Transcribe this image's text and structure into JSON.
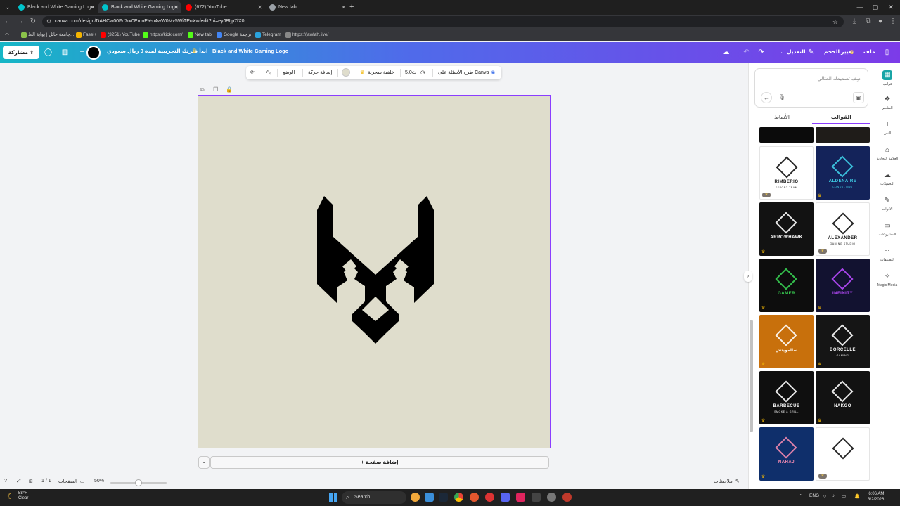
{
  "browser": {
    "tabs": [
      {
        "title": "Black and White Gaming Logo",
        "favicon_color": "#00c4cc",
        "active": false
      },
      {
        "title": "Black and White Gaming Logo",
        "favicon_color": "#00c4cc",
        "active": true
      },
      {
        "title": "(672) YouTube",
        "favicon_color": "#ff0000",
        "active": false
      },
      {
        "title": "New tab",
        "favicon_color": "#9aa0a6",
        "active": false
      }
    ],
    "url": "canva.com/design/DAHCw00Fn7o/0EmnEY-u4wW0Mv5WiTEuXw/edit?ui=eyJBIjp7fX0",
    "bookmarks": [
      {
        "label": "جامعة حائل | بوابة الط...",
        "color": "#8bc34a"
      },
      {
        "label": "Fasel+",
        "color": "#f5b400"
      },
      {
        "label": "(3251) YouTube",
        "color": "#ff0000"
      },
      {
        "label": "https://kick.com/",
        "color": "#53fc18"
      },
      {
        "label": "New tab",
        "color": "#53fc18"
      },
      {
        "label": "Google ترجمة",
        "color": "#4285f4"
      },
      {
        "label": "Telegram",
        "color": "#2aa3de"
      },
      {
        "label": "https://jawlah.live/",
        "color": "#888888"
      }
    ]
  },
  "topbar": {
    "share_label": "مشاركة",
    "promo_text": "ابدأ فترتك التجريبية لمدة 0 ريال سعودي",
    "doc_title": "Black and White Gaming Logo",
    "edit_label": "التعديل",
    "resize_label": "تغيير الحجم",
    "file_label": "ملف"
  },
  "context_toolbar": {
    "ask_canva": "طرح الأسئلة على Canva",
    "duration": "5.0ث",
    "magic_bg": "خلفية سحرية",
    "animate": "إضافة حركة",
    "position": "الوضع"
  },
  "canvas": {
    "background_color": "#dfddcc",
    "add_page_label": "+ إضافة صفحة"
  },
  "bottom_bar": {
    "notes": "ملاحظات",
    "zoom": "50%",
    "zoom_fraction": 0.5,
    "pages_label": "الصفحات",
    "page_count": "1 / 1"
  },
  "panel": {
    "search_placeholder": "صِف تصميمك المثالي",
    "tabs": [
      {
        "label": "القوالب",
        "active": true
      },
      {
        "label": "الأنماط",
        "active": false
      }
    ],
    "templates": [
      {
        "name": "",
        "sub": "",
        "bg": "#0b0b0b",
        "fg": "#ffffff"
      },
      {
        "name": "",
        "sub": "",
        "bg": "#1f1c19",
        "fg": "#c8a86a"
      },
      {
        "name": "RIMBERIO",
        "sub": "ESPORT TEAM",
        "bg": "#ffffff",
        "fg": "#111111"
      },
      {
        "name": "ALDENAIRE",
        "sub": "CONSULTING",
        "bg": "#14235a",
        "fg": "#3fd0e8"
      },
      {
        "name": "ARROWHAWK",
        "sub": "",
        "bg": "#121212",
        "fg": "#ffffff"
      },
      {
        "name": "ALEXANDER",
        "sub": "GAMING STUDIO",
        "bg": "#ffffff",
        "fg": "#111111"
      },
      {
        "name": "GAMER",
        "sub": "",
        "bg": "#0d0d0d",
        "fg": "#39d353"
      },
      {
        "name": "INFINITY",
        "sub": "",
        "bg": "#121230",
        "fg": "#b94bff"
      },
      {
        "name": "سالمويتش",
        "sub": "",
        "bg": "#c8700c",
        "fg": "#ffffff"
      },
      {
        "name": "BORCELLE",
        "sub": "GAMING",
        "bg": "#151515",
        "fg": "#ffffff"
      },
      {
        "name": "BARBECUE",
        "sub": "SMOKE & GRILL",
        "bg": "#0f0f0f",
        "fg": "#ffffff"
      },
      {
        "name": "NAKGO",
        "sub": "",
        "bg": "#121212",
        "fg": "#ffffff"
      },
      {
        "name": "NAHAJ",
        "sub": "",
        "bg": "#0f2f6b",
        "fg": "#f28ab0"
      },
      {
        "name": "",
        "sub": "",
        "bg": "#ffffff",
        "fg": "#111111"
      }
    ]
  },
  "rail": [
    {
      "label": "قوالب",
      "icon": "templates-icon",
      "glyph": "▦",
      "active": true
    },
    {
      "label": "العناصر",
      "icon": "elements-icon",
      "glyph": "❖",
      "active": false
    },
    {
      "label": "النص",
      "icon": "text-icon",
      "glyph": "T",
      "active": false
    },
    {
      "label": "العلامة التجارية",
      "icon": "brand-icon",
      "glyph": "⌂",
      "active": false
    },
    {
      "label": "التحميلات",
      "icon": "uploads-icon",
      "glyph": "☁",
      "active": false
    },
    {
      "label": "الأدوات",
      "icon": "tools-icon",
      "glyph": "✎",
      "active": false
    },
    {
      "label": "المشروعات",
      "icon": "projects-icon",
      "glyph": "▭",
      "active": false
    },
    {
      "label": "التطبيقات",
      "icon": "apps-icon",
      "glyph": "⁘",
      "active": false
    },
    {
      "label": "Magic Media",
      "icon": "magic-media-icon",
      "glyph": "✧",
      "active": false
    }
  ],
  "taskbar": {
    "weather_temp": "58°F",
    "weather_desc": "Clear",
    "search_label": "Search",
    "language": "ENG",
    "time": "6:06 AM",
    "date": "3/2/2026"
  }
}
